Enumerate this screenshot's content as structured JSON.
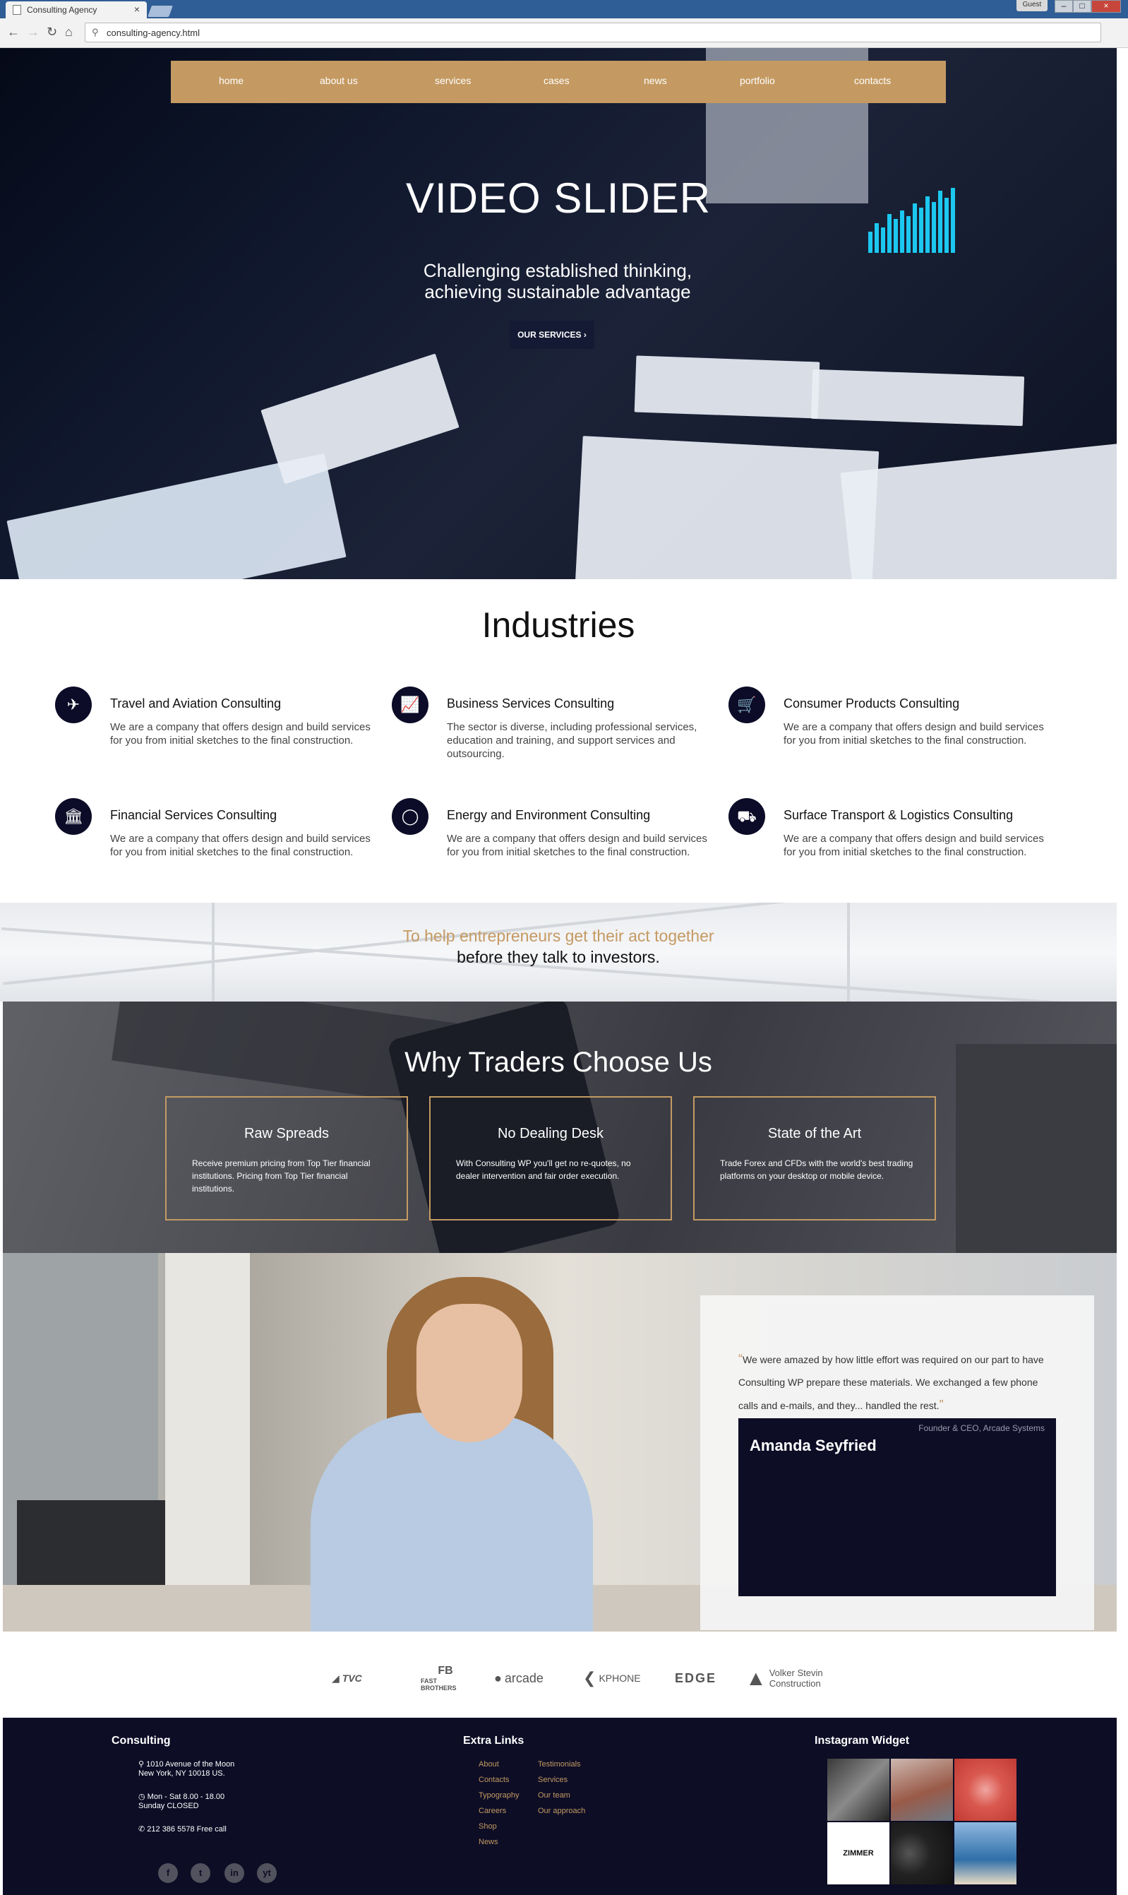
{
  "browser": {
    "tab_title": "Consulting Agency",
    "tab_close": "×",
    "guest_label": "Guest",
    "address": "consulting-agency.html",
    "win_min": "–",
    "win_max": "□",
    "win_close": "×"
  },
  "nav": {
    "items": [
      "home",
      "about us",
      "services",
      "cases",
      "news",
      "portfolio",
      "contacts"
    ]
  },
  "hero": {
    "title": "VIDEO SLIDER",
    "subtitle": "Challenging established thinking, achieving sustainable advantage",
    "button": "OUR SERVICES"
  },
  "industries": {
    "title": "Industries",
    "items": [
      {
        "title": "Travel and Aviation Consulting",
        "text": "We are a company that offers design and build services for you from initial sketches to the final construction.",
        "icon": "plane-icon"
      },
      {
        "title": "Business Services Consulting",
        "text": "The sector is diverse, including professional services, education and training, and support services and outsourcing.",
        "icon": "chart-icon"
      },
      {
        "title": "Consumer Products Consulting",
        "text": "We are a company that offers design and build services for you from initial sketches to the final construction.",
        "icon": "cart-icon"
      },
      {
        "title": "Financial Services Consulting",
        "text": "We are a company that offers design and build services for you from initial sketches to the final construction.",
        "icon": "bank-icon"
      },
      {
        "title": "Energy and Environment Consulting",
        "text": "We are a company that offers design and build services for you from initial sketches to the final construction.",
        "icon": "lightbulb-icon"
      },
      {
        "title": "Surface Transport & Logistics Consulting",
        "text": "We are a company that offers design and build services for you from initial sketches to the final construction.",
        "icon": "truck-icon"
      }
    ]
  },
  "band": {
    "line1": "To help entrepreneurs get their act together",
    "line2": "before they talk to investors."
  },
  "why": {
    "title": "Why Traders Choose Us",
    "boxes": [
      {
        "title": "Raw Spreads",
        "text": "Receive premium pricing from Top Tier financial institutions. Pricing from Top Tier financial institutions."
      },
      {
        "title": "No Dealing Desk",
        "text": "With Consulting WP you'll get no re-quotes, no dealer intervention and fair order execution."
      },
      {
        "title": "State of the Art",
        "text": "Trade Forex and CFDs with the world's best trading platforms on your desktop or mobile device."
      }
    ]
  },
  "testimonial": {
    "quote": "We were amazed by how little effort was required on our part to have Consulting WP prepare these materials. We exchanged a few phone calls and e-mails, and they... handled the rest.",
    "open_mark": "“",
    "close_mark": "”",
    "name": "Amanda Seyfried",
    "role": "Founder & CEO, Arcade Systems"
  },
  "logos": [
    "TVC",
    "FAST BROTHERS",
    "arcade",
    "KPHONE",
    "EDGE",
    "Volker Stevin Construction"
  ],
  "footer": {
    "col1_title": "Consulting",
    "address1": "1010 Avenue of the Moon",
    "address2": "New York, NY 10018 US.",
    "hours1": "Mon - Sat 8.00 - 18.00",
    "hours2": "Sunday CLOSED",
    "phone": "212 386 5578 Free call",
    "col2_title": "Extra Links",
    "links_a": [
      "About",
      "Contacts",
      "Typography",
      "Careers",
      "Shop",
      "News"
    ],
    "links_b": [
      "Testimonials",
      "Services",
      "Our team",
      "Our approach"
    ],
    "col3_title": "Instagram Widget",
    "insta_label": "ZIMMER",
    "social": [
      "f",
      "t",
      "in",
      "yt"
    ]
  },
  "colors": {
    "accent": "#c49a62",
    "navy": "#0d0d26"
  }
}
